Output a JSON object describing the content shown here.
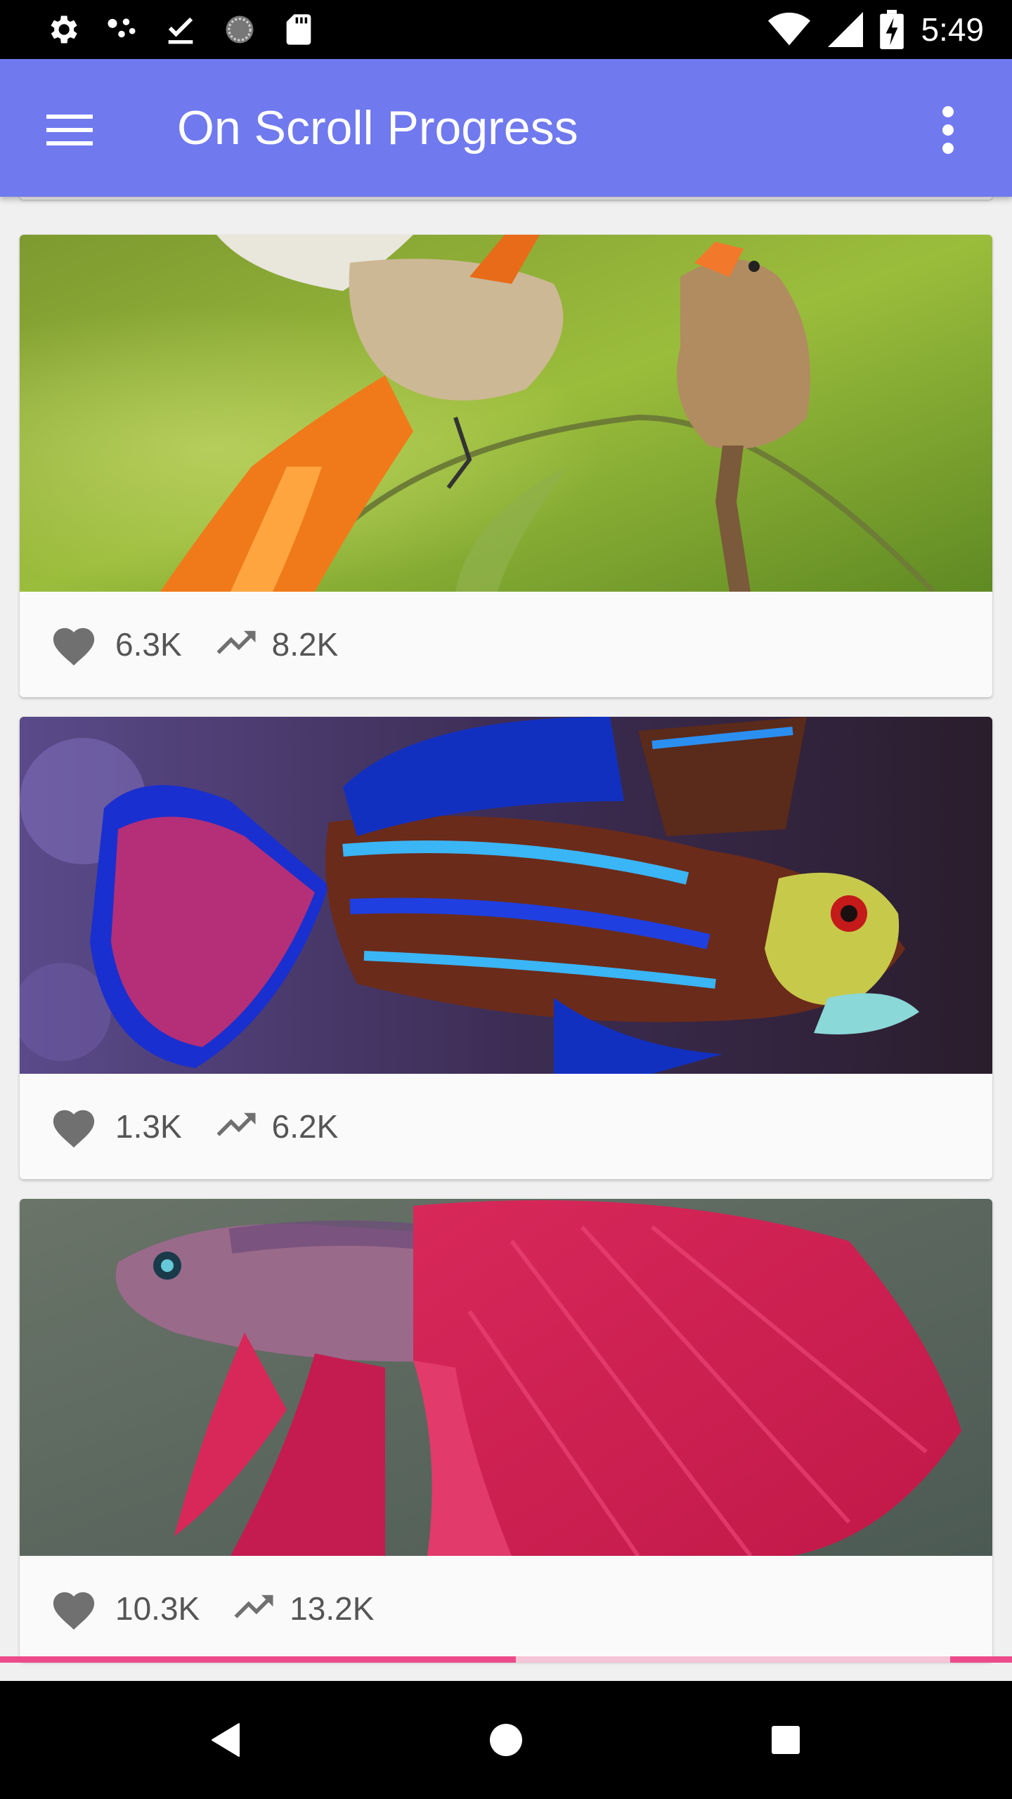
{
  "status_bar": {
    "time": "5:49",
    "left_icons": [
      "settings-icon",
      "share-dots-icon",
      "download-done-icon",
      "sync-circle-icon",
      "sd-card-icon"
    ],
    "right_icons": [
      "wifi-icon",
      "signal-icon",
      "battery-charging-icon"
    ]
  },
  "app_bar": {
    "title": "On Scroll Progress",
    "menu_icon": "menu-icon",
    "more_icon": "more-vert-icon",
    "color": "#7079ee"
  },
  "cards": [
    {
      "image": "birds-photo",
      "likes": "6.3K",
      "trending": "8.2K"
    },
    {
      "image": "mandarin-fish-photo",
      "likes": "1.3K",
      "trending": "6.2K"
    },
    {
      "image": "betta-fish-photo",
      "likes": "10.3K",
      "trending": "13.2K"
    }
  ],
  "scroll_progress": {
    "color": "#ec4b89",
    "track_color": "#f5c4d6",
    "value_percent": 51
  },
  "nav_bar": {
    "buttons": [
      "back-icon",
      "home-icon",
      "recents-icon"
    ]
  }
}
